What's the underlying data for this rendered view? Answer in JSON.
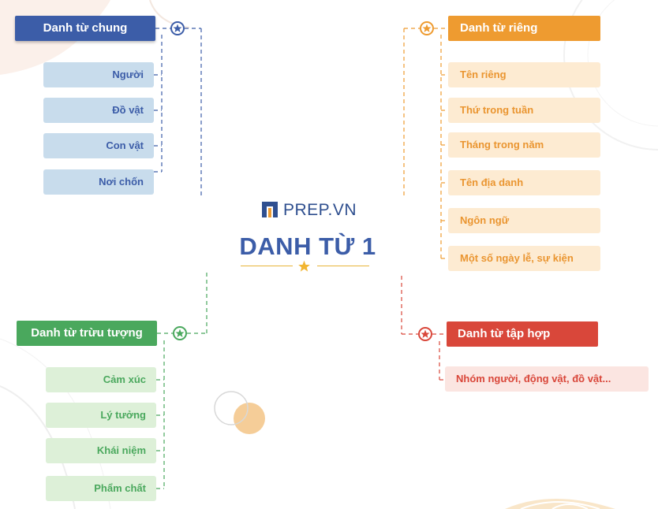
{
  "logo": {
    "text": "PREP.VN"
  },
  "center": {
    "title": "DANH TỪ 1"
  },
  "branches": {
    "common": {
      "title": "Danh từ chung",
      "color": "#3c5da8",
      "items": [
        "Người",
        "Đồ vật",
        "Con vật",
        "Nơi chốn"
      ]
    },
    "proper": {
      "title": "Danh từ riêng",
      "color": "#ee9b30",
      "items": [
        "Tên riêng",
        "Thứ trong tuần",
        "Tháng trong năm",
        "Tên địa danh",
        "Ngôn ngữ",
        "Một số ngày lễ, sự kiện"
      ]
    },
    "abstract": {
      "title": "Danh từ trừu tượng",
      "color": "#4aa85d",
      "items": [
        "Cảm xúc",
        "Lý tưởng",
        "Khái niệm",
        "Phẩm chất"
      ]
    },
    "collective": {
      "title": "Danh từ tập hợp",
      "color": "#d9473a",
      "items": [
        "Nhóm người, động vật, đồ vật..."
      ]
    }
  },
  "icons": {
    "node": "star-circle-icon",
    "center": "star-icon",
    "logo": "prep-logo-icon"
  }
}
